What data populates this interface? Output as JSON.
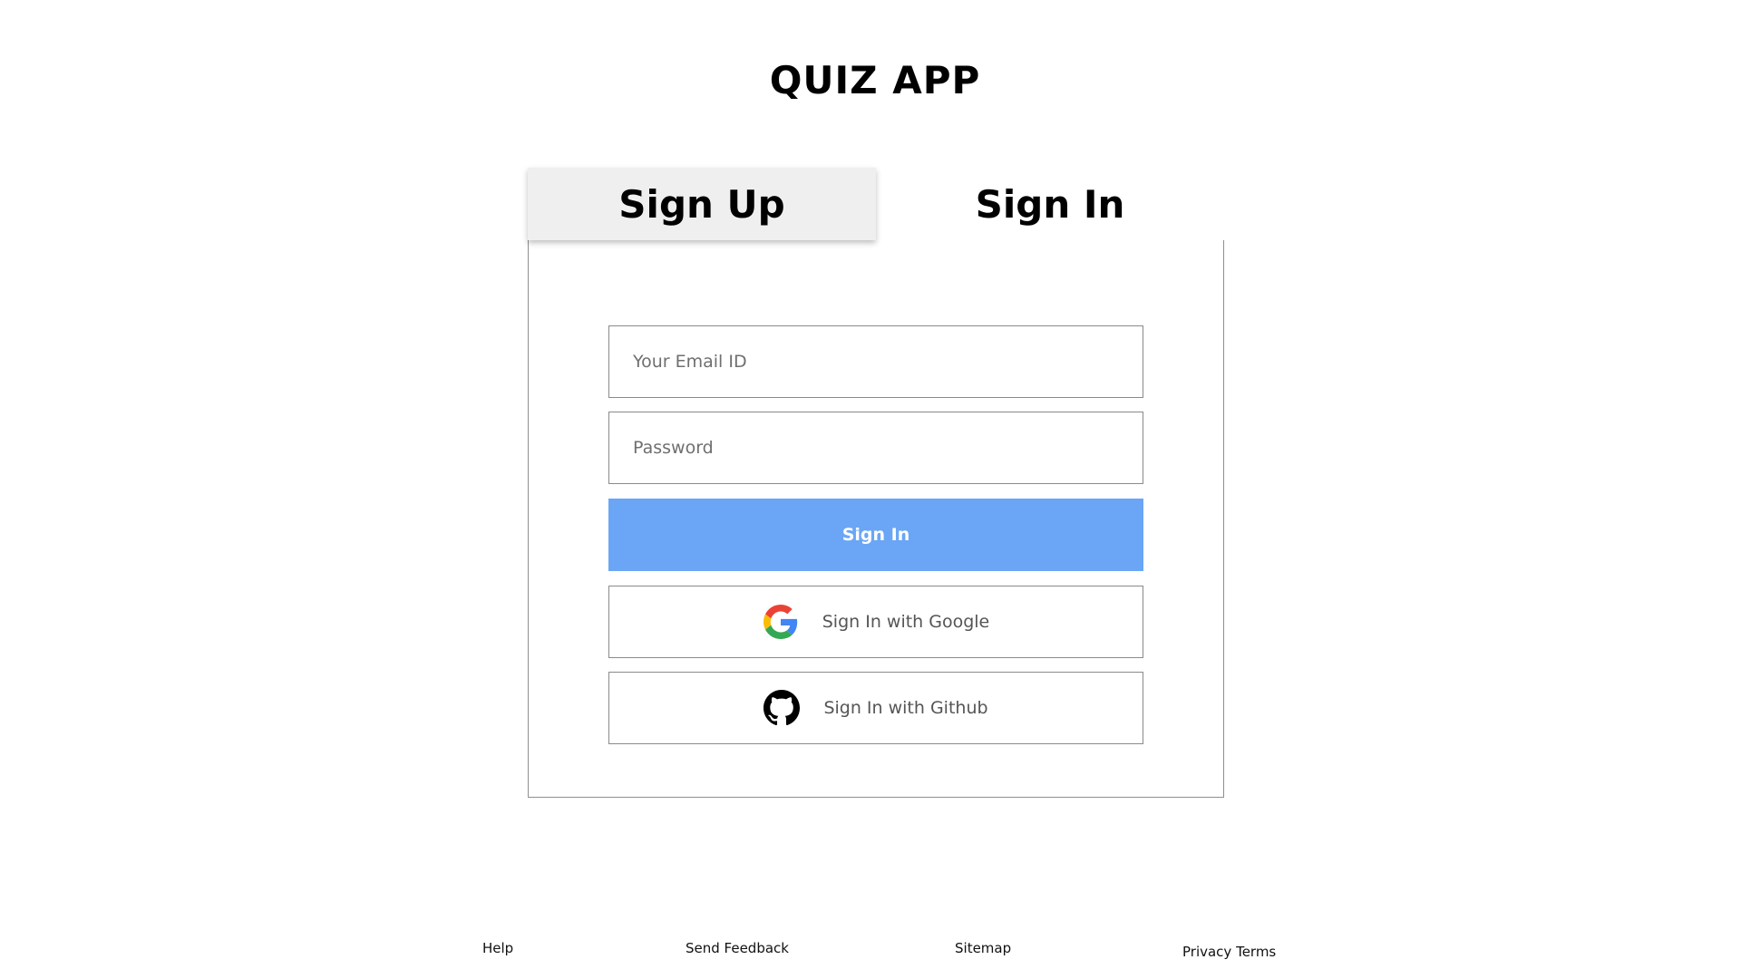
{
  "app": {
    "title": "QUIZ APP"
  },
  "tabs": {
    "signup_label": "Sign Up",
    "signin_label": "Sign In",
    "active": "signin"
  },
  "form": {
    "email_placeholder": "Your Email ID",
    "email_value": "",
    "password_placeholder": "Password",
    "password_value": "",
    "submit_label": "Sign In"
  },
  "social": {
    "google_label": "Sign In with Google",
    "github_label": "Sign In with Github"
  },
  "footer": {
    "help": "Help",
    "send_feedback": "Send Feedback",
    "sitemap": "Sitemap",
    "privacy_terms": "Privacy Terms"
  },
  "colors": {
    "primary_button": "#6aa6f5",
    "inactive_tab": "#efefef",
    "border": "#8a8a8a"
  },
  "icons": {
    "google": "google-icon",
    "github": "github-icon"
  }
}
